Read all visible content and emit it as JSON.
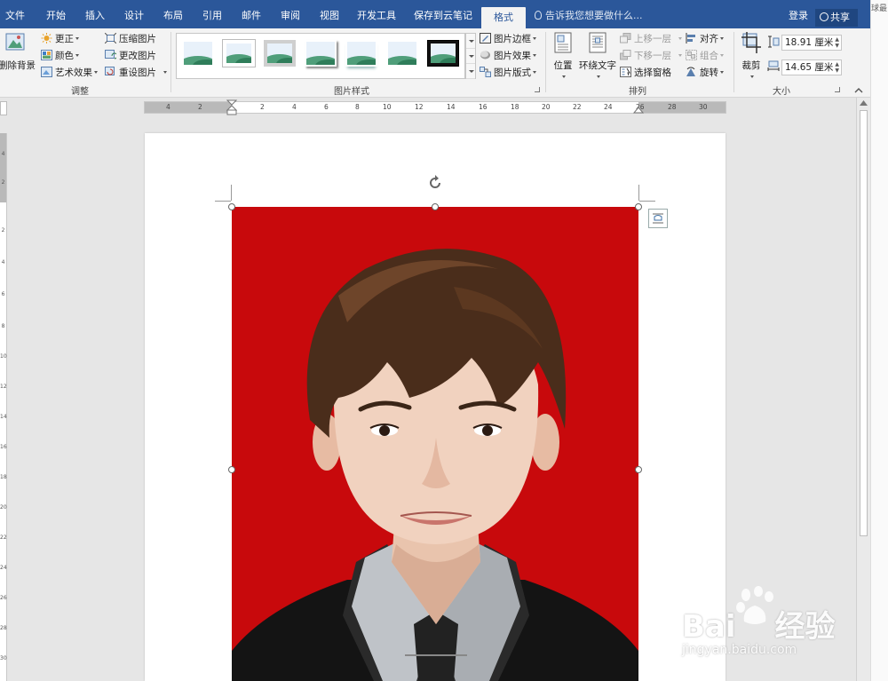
{
  "tabs": [
    {
      "label": "文件",
      "active": false
    },
    {
      "label": "开始",
      "active": false
    },
    {
      "label": "插入",
      "active": false
    },
    {
      "label": "设计",
      "active": false
    },
    {
      "label": "布局",
      "active": false
    },
    {
      "label": "引用",
      "active": false
    },
    {
      "label": "邮件",
      "active": false
    },
    {
      "label": "审阅",
      "active": false
    },
    {
      "label": "视图",
      "active": false
    },
    {
      "label": "开发工具",
      "active": false
    },
    {
      "label": "保存到云笔记",
      "active": false
    },
    {
      "label": "格式",
      "active": true
    }
  ],
  "tell_me": "告诉我您想要做什么...",
  "login": "登录",
  "share": "共享",
  "ribbon": {
    "adjust": {
      "remove_bg": "删除背景",
      "corrections": "更正",
      "color": "颜色",
      "artistic": "艺术效果",
      "compress": "压缩图片",
      "change": "更改图片",
      "reset": "重设图片",
      "label": "调整"
    },
    "styles": {
      "border": "图片边框",
      "effects": "图片效果",
      "layout": "图片版式",
      "label": "图片样式"
    },
    "arrange": {
      "position": "位置",
      "wrap": "环绕文字",
      "forward": "上移一层",
      "backward": "下移一层",
      "selection_pane": "选择窗格",
      "align": "对齐",
      "group": "组合",
      "rotate": "旋转",
      "label": "排列"
    },
    "size": {
      "crop": "裁剪",
      "height": "18.91 厘米",
      "width": "14.65 厘米",
      "label": "大小"
    }
  },
  "ruler": {
    "h_ticks": [
      "4",
      "2",
      "2",
      "4",
      "6",
      "8",
      "10",
      "12",
      "14",
      "16",
      "18",
      "20",
      "22",
      "24",
      "26",
      "28",
      "30"
    ],
    "v_ticks": [
      "4",
      "2",
      "2",
      "4",
      "6",
      "8",
      "10",
      "12",
      "14",
      "16",
      "18",
      "20",
      "22",
      "24",
      "26",
      "28",
      "30"
    ]
  },
  "right_strip": "球最",
  "watermark": {
    "brand_left": "Bai",
    "brand_right": "经验",
    "url": "jingyan.baidu.com"
  },
  "colors": {
    "tabbar": "#2b579a",
    "photo_bg": "#c8090c"
  }
}
